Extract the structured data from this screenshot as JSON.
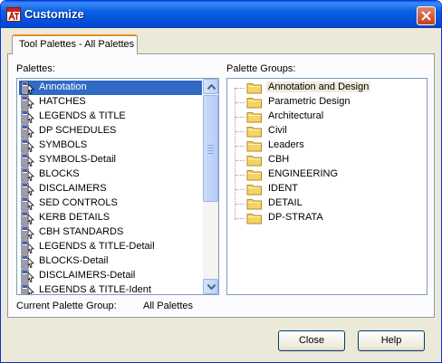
{
  "window": {
    "title": "Customize",
    "app_icon": "autocad-icon",
    "close_icon": "close-icon"
  },
  "tabs": [
    {
      "label": "Tool Palettes - All Palettes",
      "active": true
    }
  ],
  "palettes": {
    "label": "Palettes:",
    "selected_index": 0,
    "items": [
      "Annotation",
      "HATCHES",
      "LEGENDS & TITLE",
      "DP SCHEDULES",
      "SYMBOLS",
      "SYMBOLS-Detail",
      "BLOCKS",
      "DISCLAIMERS",
      "SED CONTROLS",
      "KERB DETAILS",
      "CBH STANDARDS",
      "LEGENDS & TITLE-Detail",
      "BLOCKS-Detail",
      "DISCLAIMERS-Detail",
      "LEGENDS & TITLE-Ident"
    ],
    "item_icon": "palette-icon"
  },
  "palette_groups": {
    "label": "Palette Groups:",
    "selected_index": 0,
    "items": [
      "Annotation and Design",
      "Parametric Design",
      "Architectural",
      "Civil",
      "Leaders",
      "CBH",
      "ENGINEERING",
      "IDENT",
      "DETAIL",
      "DP-STRATA"
    ],
    "item_icon": "folder-icon"
  },
  "current_group": {
    "label": "Current Palette Group:",
    "value": "All Palettes"
  },
  "buttons": {
    "close": "Close",
    "help": "Help"
  },
  "colors": {
    "title_bar": "#0a5fe0",
    "selection": "#316ac5",
    "tree_selection": "#f1ebdd",
    "tab_highlight": "#e68b2c"
  }
}
